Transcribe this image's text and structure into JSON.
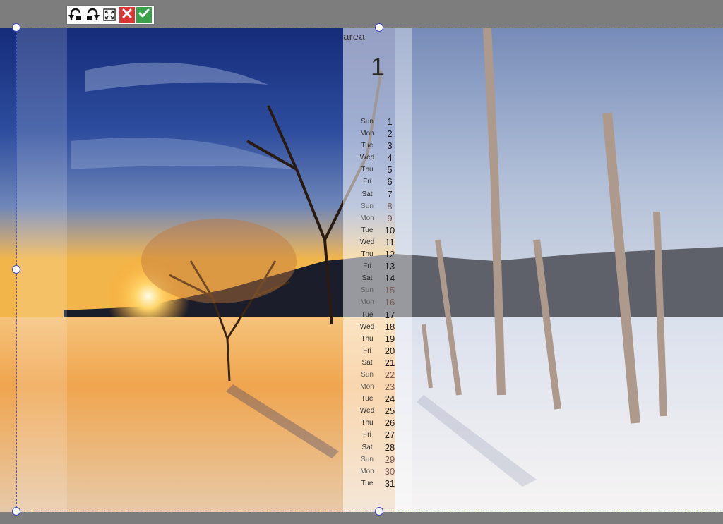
{
  "toolbar": {
    "buttons": [
      {
        "name": "rotate-left-icon"
      },
      {
        "name": "rotate-right-icon"
      },
      {
        "name": "fullscreen-icon"
      },
      {
        "name": "cancel-icon",
        "color": "#d83434"
      },
      {
        "name": "confirm-icon",
        "color": "#3aa14a"
      }
    ]
  },
  "calendar": {
    "area_label": "c area",
    "month_number": "1",
    "days": [
      {
        "name": "Sun",
        "num": "1"
      },
      {
        "name": "Mon",
        "num": "2"
      },
      {
        "name": "Tue",
        "num": "3"
      },
      {
        "name": "Wed",
        "num": "4"
      },
      {
        "name": "Thu",
        "num": "5"
      },
      {
        "name": "Fri",
        "num": "6"
      },
      {
        "name": "Sat",
        "num": "7"
      },
      {
        "name": "Sun",
        "num": "8"
      },
      {
        "name": "Mon",
        "num": "9"
      },
      {
        "name": "Tue",
        "num": "10"
      },
      {
        "name": "Wed",
        "num": "11"
      },
      {
        "name": "Thu",
        "num": "12"
      },
      {
        "name": "Fri",
        "num": "13"
      },
      {
        "name": "Sat",
        "num": "14"
      },
      {
        "name": "Sun",
        "num": "15"
      },
      {
        "name": "Mon",
        "num": "16"
      },
      {
        "name": "Tue",
        "num": "17"
      },
      {
        "name": "Wed",
        "num": "18"
      },
      {
        "name": "Thu",
        "num": "19"
      },
      {
        "name": "Fri",
        "num": "20"
      },
      {
        "name": "Sat",
        "num": "21"
      },
      {
        "name": "Sun",
        "num": "22"
      },
      {
        "name": "Mon",
        "num": "23"
      },
      {
        "name": "Tue",
        "num": "24"
      },
      {
        "name": "Wed",
        "num": "25"
      },
      {
        "name": "Thu",
        "num": "26"
      },
      {
        "name": "Fri",
        "num": "27"
      },
      {
        "name": "Sat",
        "num": "28"
      },
      {
        "name": "Sun",
        "num": "29"
      },
      {
        "name": "Mon",
        "num": "30"
      },
      {
        "name": "Tue",
        "num": "31"
      }
    ]
  },
  "colors": {
    "selection_border": "#4a57d6",
    "background": "#7d7d7d"
  }
}
